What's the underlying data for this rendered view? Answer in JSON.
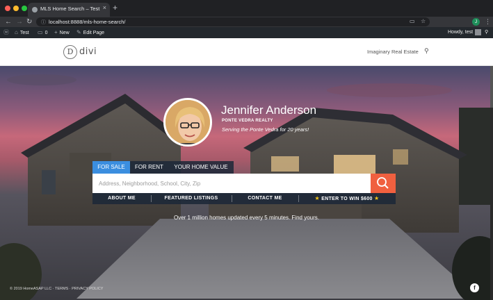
{
  "browser": {
    "tab_title": "MLS Home Search – Test",
    "url": "localhost:8888/mls-home-search/",
    "profile_initial": "J"
  },
  "admin_bar": {
    "site_name": "Test",
    "comments_count": "0",
    "new_label": "New",
    "edit_label": "Edit Page",
    "greeting": "Howdy, test"
  },
  "site": {
    "logo_letter": "D",
    "logo_text": "divi",
    "nav_item": "Imaginary Real Estate"
  },
  "agent": {
    "name": "Jennifer Anderson",
    "company": "PONTE VEDRA REALTY",
    "tagline": "Serving the Ponte Vedra for 20 years!"
  },
  "search": {
    "tabs": [
      "FOR SALE",
      "FOR RENT",
      "YOUR HOME VALUE"
    ],
    "active_tab": "FOR SALE",
    "placeholder": "Address, Neighborhood, School, City, Zip"
  },
  "sub_nav": [
    "ABOUT ME",
    "FEATURED LISTINGS",
    "CONTACT ME",
    "ENTER TO WIN $600"
  ],
  "hero_note": "Over 1 million homes updated every 5 minutes. Find yours.",
  "footer": {
    "copyright": "© 2019 HomeASAP LLC · TERMS · PRIVACY POLICY",
    "facebook_letter": "f"
  },
  "colors": {
    "accent_blue": "#3b8edf",
    "search_orange": "#f0603f"
  }
}
